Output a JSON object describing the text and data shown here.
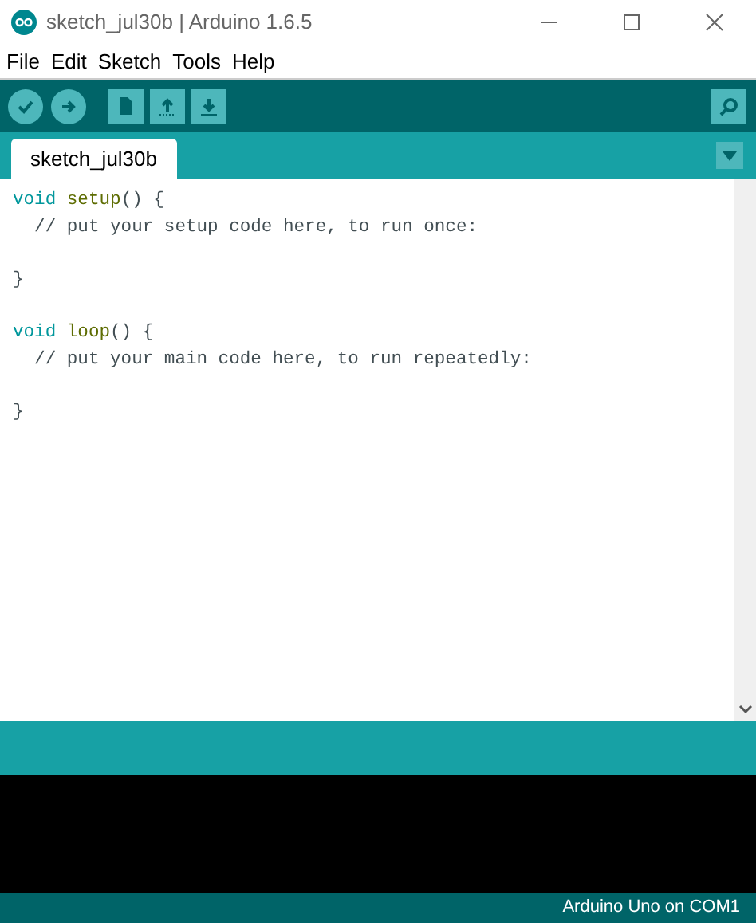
{
  "window": {
    "title": "sketch_jul30b | Arduino 1.6.5"
  },
  "menu": [
    "File",
    "Edit",
    "Sketch",
    "Tools",
    "Help"
  ],
  "tabs": [
    {
      "label": "sketch_jul30b",
      "selected": true
    }
  ],
  "code": [
    {
      "kind": "code",
      "tokens": [
        {
          "text": "void ",
          "kind": "keyword"
        },
        {
          "text": "setup",
          "kind": "function"
        },
        {
          "text": "() {",
          "kind": "plain"
        }
      ]
    },
    {
      "kind": "code",
      "tokens": [
        {
          "text": "  // put your setup code here, to run once:",
          "kind": "comment"
        }
      ]
    },
    {
      "kind": "blank"
    },
    {
      "kind": "code",
      "tokens": [
        {
          "text": "}",
          "kind": "plain"
        }
      ]
    },
    {
      "kind": "blank"
    },
    {
      "kind": "code",
      "tokens": [
        {
          "text": "void ",
          "kind": "keyword"
        },
        {
          "text": "loop",
          "kind": "function"
        },
        {
          "text": "() {",
          "kind": "plain"
        }
      ]
    },
    {
      "kind": "code",
      "tokens": [
        {
          "text": "  // put your main code here, to run repeatedly:",
          "kind": "comment"
        }
      ]
    },
    {
      "kind": "blank"
    },
    {
      "kind": "code",
      "tokens": [
        {
          "text": "}",
          "kind": "plain"
        }
      ]
    }
  ],
  "status_bar": {
    "board": "Arduino Uno on COM1"
  }
}
